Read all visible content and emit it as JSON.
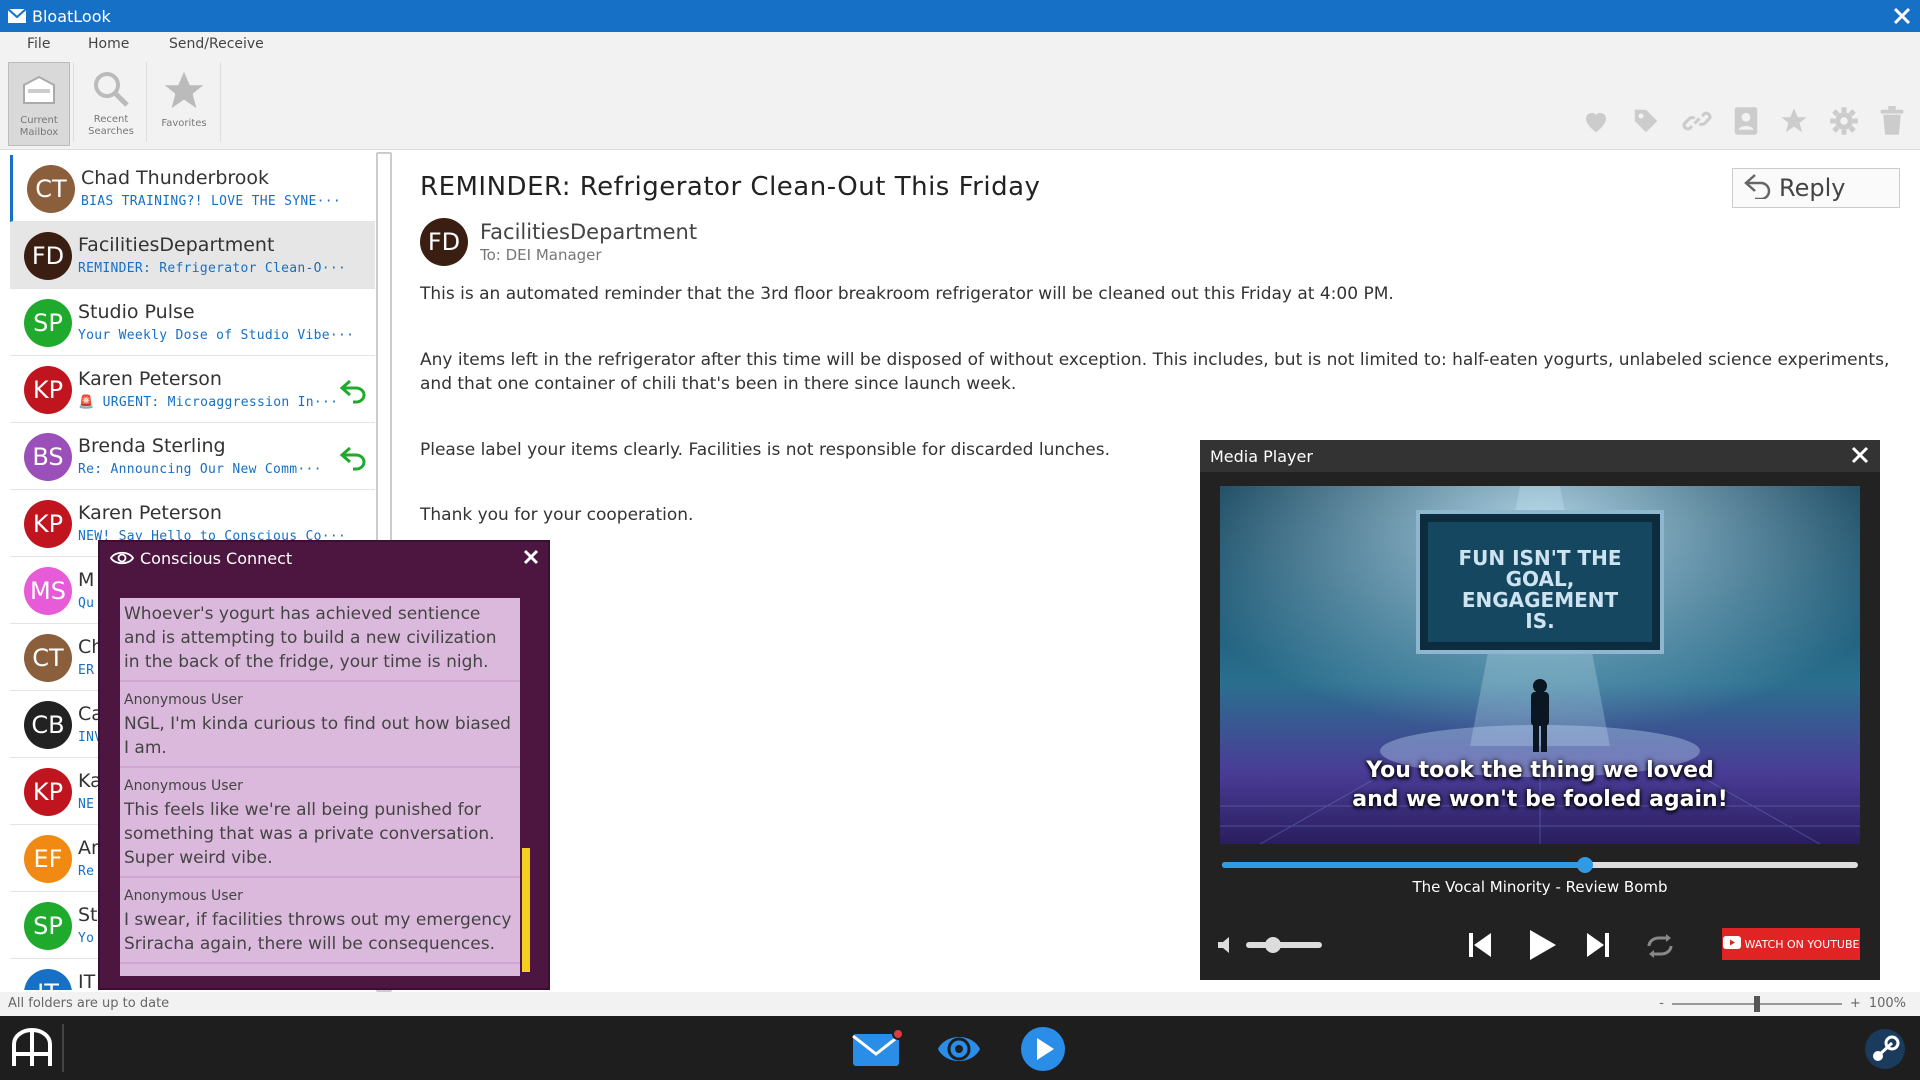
{
  "app": {
    "title": "BloatLook"
  },
  "menu": {
    "file": "File",
    "home": "Home",
    "send_receive": "Send/Receive"
  },
  "ribbon": {
    "current_mailbox_1": "Current",
    "current_mailbox_2": "Mailbox",
    "recent_searches_1": "Recent",
    "recent_searches_2": "Searches",
    "favorites": "Favorites",
    "toolbar_icons": [
      "heart-icon",
      "tag-icon",
      "link-icon",
      "contact-icon",
      "star-icon",
      "gear-icon",
      "trash-icon"
    ]
  },
  "messages": [
    {
      "initials": "CT",
      "name": "Chad Thunderbrook",
      "preview": "BIAS TRAINING?! LOVE THE SYNE···",
      "color": "#8b5e3c",
      "replied": false
    },
    {
      "initials": "FD",
      "name": "FacilitiesDepartment",
      "preview": "REMINDER: Refrigerator Clean-O···",
      "color": "#3b1e12",
      "replied": false
    },
    {
      "initials": "SP",
      "name": "Studio Pulse",
      "preview": "Your Weekly Dose of Studio Vibe···",
      "color": "#1faa2e",
      "replied": false
    },
    {
      "initials": "KP",
      "name": "Karen Peterson",
      "preview": "🚨 URGENT: Microaggression In···",
      "color": "#c0151f",
      "replied": true
    },
    {
      "initials": "BS",
      "name": "Brenda Sterling",
      "preview": "Re: Announcing Our New Comm···",
      "color": "#9b4fb8",
      "replied": true
    },
    {
      "initials": "KP",
      "name": "Karen Peterson",
      "preview": "NEW! Say Hello to Conscious Co···",
      "color": "#c0151f",
      "replied": false
    },
    {
      "initials": "MS",
      "name": "M",
      "preview": "Qu",
      "color": "#e85bd8",
      "replied": false
    },
    {
      "initials": "CT",
      "name": "Ch",
      "preview": "ER",
      "color": "#8b5e3c",
      "replied": false
    },
    {
      "initials": "CB",
      "name": "Ca",
      "preview": "INV",
      "color": "#222222",
      "replied": false
    },
    {
      "initials": "KP",
      "name": "Ka",
      "preview": "NE",
      "color": "#c0151f",
      "replied": false
    },
    {
      "initials": "EF",
      "name": "An",
      "preview": "Re",
      "color": "#f08a12",
      "replied": false
    },
    {
      "initials": "SP",
      "name": "St",
      "preview": "Yo",
      "color": "#1faa2e",
      "replied": false
    },
    {
      "initials": "IT",
      "name": "IT",
      "preview": "",
      "color": "#1670c6",
      "replied": false
    }
  ],
  "email": {
    "subject": "REMINDER: Refrigerator Clean-Out This Friday",
    "reply_label": "Reply",
    "sender_initials": "FD",
    "sender": "FacilitiesDepartment",
    "to": "To:  DEI Manager",
    "p1": "This is an automated reminder that the 3rd floor breakroom refrigerator will be cleaned out this Friday at 4:00 PM.",
    "p2": "Any items left in the refrigerator after this time will be disposed of without exception. This includes, but is not limited to: half-eaten yogurts, unlabeled science experiments, and that one container of chili that's been in there since launch week.",
    "p3": "Please label your items clearly. Facilities is not responsible for discarded lunches.",
    "p4": "Thank you for your cooperation."
  },
  "conscious_connect": {
    "title": "Conscious Connect",
    "posts": [
      {
        "user": "",
        "text": "Whoever's yogurt has achieved sentience and is attempting to build a new civilization in the back of the fridge, your time is nigh."
      },
      {
        "user": "Anonymous User",
        "text": "NGL, I'm kinda curious to find out how biased I am."
      },
      {
        "user": "Anonymous User",
        "text": "This feels like we're all being punished for something that was a private conversation. Super weird vibe."
      },
      {
        "user": "Anonymous User",
        "text": "I swear, if facilities throws out my emergency Sriracha again, there will be consequences."
      }
    ]
  },
  "media_player": {
    "title": "Media Player",
    "screen_text": "FUN ISN'T THE GOAL, ENGAGEMENT IS.",
    "caption_1": "You took the thing we loved",
    "caption_2": "and we won't be fooled again!",
    "track_title": "The Vocal Minority - Review Bomb",
    "progress": 0.57,
    "volume": 0.3,
    "youtube_label": "WATCH ON YOUTUBE"
  },
  "status": {
    "text": "All folders are up to date",
    "zoom_minus": "-",
    "zoom_plus": "+",
    "zoom": "100%"
  },
  "taskbar": {
    "notification": true
  }
}
